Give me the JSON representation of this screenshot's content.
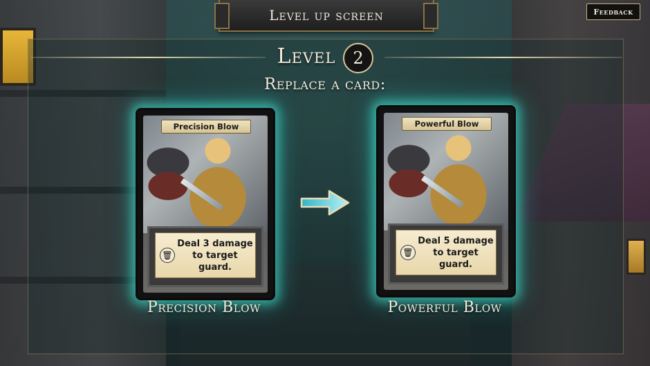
{
  "header": {
    "title": "Level up screen"
  },
  "feedback_button": {
    "label": "Feedback"
  },
  "level": {
    "label": "Level",
    "number": "2"
  },
  "prompt": "Replace a card:",
  "cards": {
    "old": {
      "title": "Precision Blow",
      "effect": "Deal 3 damage to target guard.",
      "name": "Precision Blow",
      "icon": "trash-icon"
    },
    "new": {
      "title": "Powerful Blow",
      "effect": "Deal 5 damage to target guard.",
      "name": "Powerful Blow",
      "icon": "trash-icon"
    }
  },
  "colors": {
    "glow": "#46e6d2",
    "text_light": "#f3ecdb",
    "gold_border": "#8a7346"
  }
}
